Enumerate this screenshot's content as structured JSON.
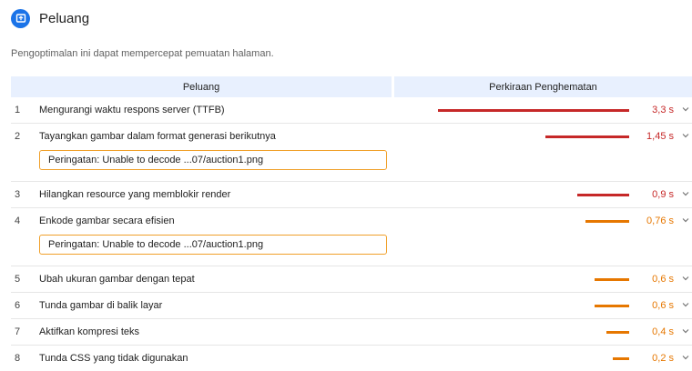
{
  "section": {
    "title": "Peluang",
    "description": "Pengoptimalan ini dapat mempercepat pemuatan halaman.",
    "icon": "opportunity-icon",
    "accent": "#1a73e8"
  },
  "table": {
    "headers": {
      "opportunity": "Peluang",
      "savings": "Perkiraan Penghematan"
    },
    "rows": [
      {
        "num": "1",
        "title": "Mengurangi waktu respons server (TTFB)",
        "value": "3,3 s",
        "severity": "red",
        "savings_fraction": 1.0,
        "warning": ""
      },
      {
        "num": "2",
        "title": "Tayangkan gambar dalam format generasi berikutnya",
        "value": "1,45 s",
        "severity": "red",
        "savings_fraction": 0.44,
        "warning": "Peringatan: Unable to decode ...07/auction1.png"
      },
      {
        "num": "3",
        "title": "Hilangkan resource yang memblokir render",
        "value": "0,9 s",
        "severity": "red",
        "savings_fraction": 0.27,
        "warning": ""
      },
      {
        "num": "4",
        "title": "Enkode gambar secara efisien",
        "value": "0,76 s",
        "severity": "orange",
        "savings_fraction": 0.23,
        "warning": "Peringatan: Unable to decode ...07/auction1.png"
      },
      {
        "num": "5",
        "title": "Ubah ukuran gambar dengan tepat",
        "value": "0,6 s",
        "severity": "orange",
        "savings_fraction": 0.18,
        "warning": ""
      },
      {
        "num": "6",
        "title": "Tunda gambar di balik layar",
        "value": "0,6 s",
        "severity": "orange",
        "savings_fraction": 0.18,
        "warning": ""
      },
      {
        "num": "7",
        "title": "Aktifkan kompresi teks",
        "value": "0,4 s",
        "severity": "orange",
        "savings_fraction": 0.12,
        "warning": ""
      },
      {
        "num": "8",
        "title": "Tunda CSS yang tidak digunakan",
        "value": "0,2 s",
        "severity": "orange",
        "savings_fraction": 0.06,
        "warning": ""
      }
    ]
  }
}
